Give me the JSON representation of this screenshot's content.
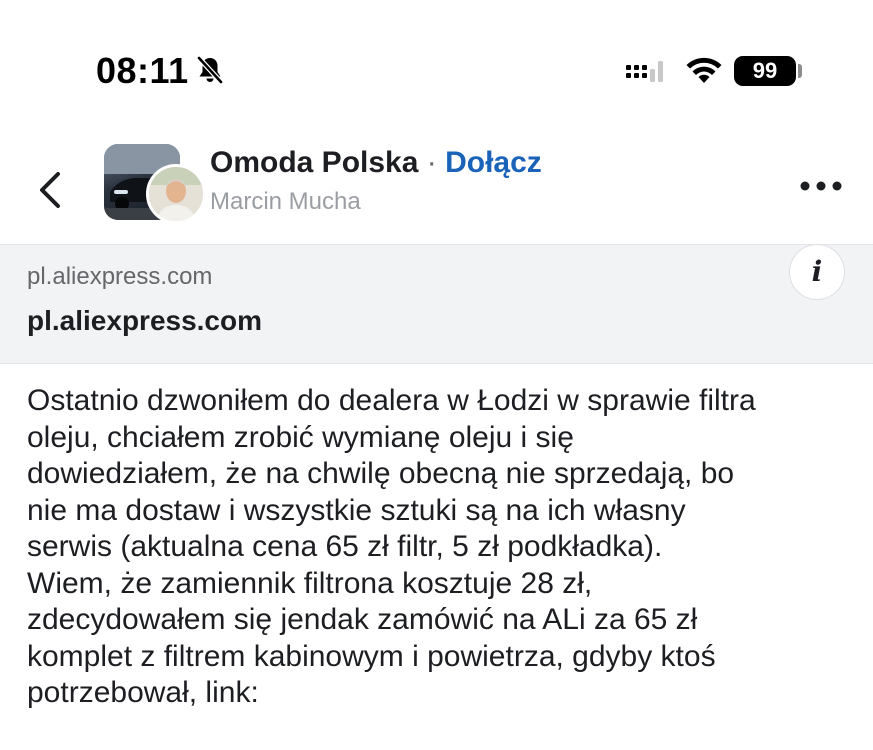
{
  "status_bar": {
    "time": "08:11",
    "battery": "99",
    "icons": [
      "bell-slash-icon",
      "cellular-signal-icon",
      "wifi-icon",
      "battery-icon"
    ]
  },
  "header": {
    "group_name": "Omoda Polska",
    "separator": "·",
    "join_label": "Dołącz",
    "author": "Marcin Mucha",
    "icons": [
      "chevron-left-icon",
      "more-horizontal-icon"
    ]
  },
  "link_preview": {
    "domain": "pl.aliexpress.com",
    "title": "pl.aliexpress.com",
    "info_label": "i"
  },
  "post": {
    "lines": [
      "Ostatnio dzwoniłem do dealera w Łodzi w sprawie filtra",
      "oleju, chciałem zrobić wymianę oleju i się",
      "dowiedziałem, że na chwilę obecną nie sprzedają, bo",
      "nie ma dostaw i wszystkie sztuki są na ich własny",
      "serwis (aktualna cena 65 zł filtr, 5 zł podkładka).",
      "Wiem, że zamiennik filtrona kosztuje 28 zł,",
      "zdecydowałem się jendak zamówić na ALi za 65 zł",
      "komplet z filtrem kabinowym i powietrza, gdyby ktoś",
      "potrzebował, link:"
    ]
  },
  "colors": {
    "accent_link": "#1a63b8",
    "text_primary": "#1c1e21",
    "text_secondary": "#65676b",
    "preview_bg": "#f2f3f5"
  }
}
